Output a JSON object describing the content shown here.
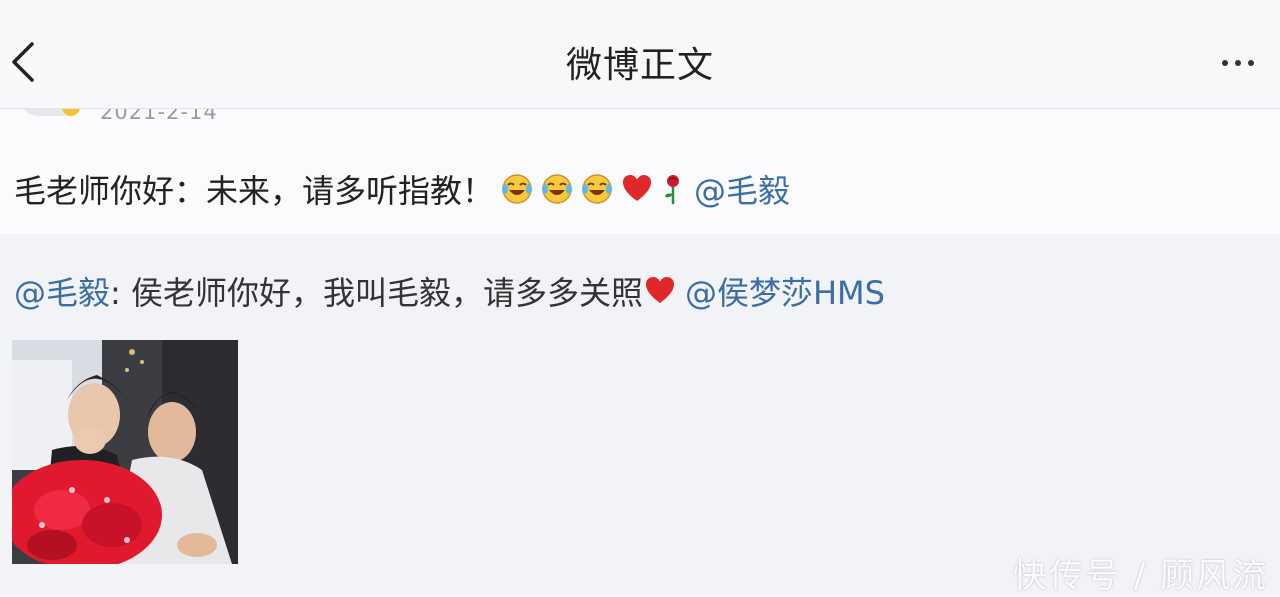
{
  "navbar": {
    "title": "微博正文"
  },
  "post": {
    "date": "2021-2-14",
    "text": "毛老师你好：未来，请多听指教！",
    "emojis": [
      "laugh-cry",
      "laugh-cry",
      "laugh-cry",
      "heart",
      "rose"
    ],
    "mention": "@毛毅"
  },
  "repost": {
    "mention_author": "@毛毅",
    "text": ": 侯老师你好，我叫毛毅，请多多关照",
    "mention_target": "@侯梦莎HMS"
  },
  "watermark": "快传号 / 顾风流",
  "colors": {
    "link": "#3a6ea5",
    "repost_bg": "#f2f3f7",
    "heart": "#e0282b"
  }
}
